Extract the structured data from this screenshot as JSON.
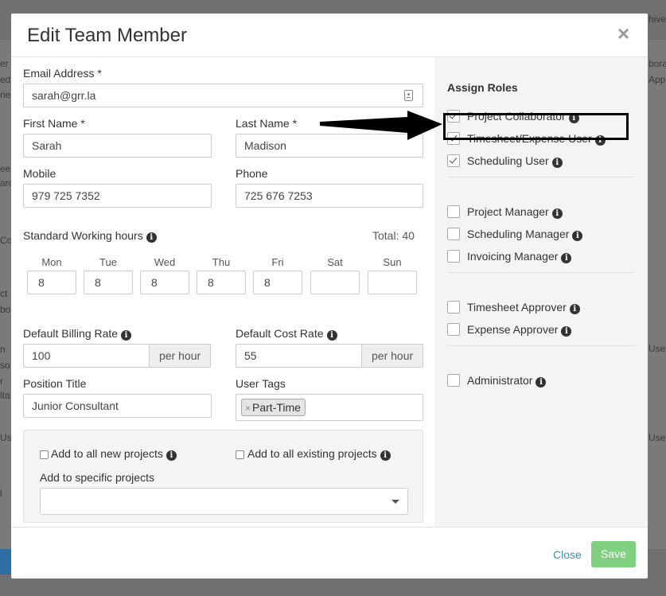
{
  "modal": {
    "title": "Edit Team Member",
    "close_glyph": "×"
  },
  "form": {
    "email_label": "Email Address",
    "email_value": "sarah@grr.la",
    "first_name_label": "First Name",
    "first_name_value": "Sarah",
    "last_name_label": "Last Name",
    "last_name_value": "Madison",
    "mobile_label": "Mobile",
    "mobile_value": "979 725 7352",
    "phone_label": "Phone",
    "phone_value": "725 676 7253",
    "required_mark": "*",
    "hours_label": "Standard Working hours",
    "hours_total": "Total: 40",
    "days": [
      {
        "name": "Mon",
        "value": "8"
      },
      {
        "name": "Tue",
        "value": "8"
      },
      {
        "name": "Wed",
        "value": "8"
      },
      {
        "name": "Thu",
        "value": "8"
      },
      {
        "name": "Fri",
        "value": "8"
      },
      {
        "name": "Sat",
        "value": ""
      },
      {
        "name": "Sun",
        "value": ""
      }
    ],
    "billing_rate_label": "Default Billing Rate",
    "billing_rate_value": "100",
    "cost_rate_label": "Default Cost Rate",
    "cost_rate_value": "55",
    "per_hour": "per hour",
    "position_label": "Position Title",
    "position_value": "Junior Consultant",
    "tags_label": "User Tags",
    "tags": [
      "Part-Time"
    ],
    "tag_remove_glyph": "×",
    "add_new_projects": "Add to all new projects",
    "add_existing_projects": "Add to all existing projects",
    "add_specific_projects": "Add to specific projects",
    "info_glyph": "i"
  },
  "roles": {
    "title": "Assign Roles",
    "groups": [
      [
        {
          "label": "Project Collaborator",
          "checked": true
        },
        {
          "label": "Timesheet/Expense User",
          "checked": true
        },
        {
          "label": "Scheduling User",
          "checked": true
        }
      ],
      [
        {
          "label": "Project Manager",
          "checked": false
        },
        {
          "label": "Scheduling Manager",
          "checked": false
        },
        {
          "label": "Invoicing Manager",
          "checked": false
        }
      ],
      [
        {
          "label": "Timesheet Approver",
          "checked": false
        },
        {
          "label": "Expense Approver",
          "checked": false
        }
      ],
      [
        {
          "label": "Administrator",
          "checked": false
        }
      ]
    ]
  },
  "footer": {
    "close_label": "Close",
    "save_label": "Save"
  },
  "background": {
    "right_fragments": [
      "hive",
      "bora",
      "Appr",
      "Use",
      "Use"
    ],
    "left_fragments": [
      "er",
      "ed",
      "ne",
      "ee",
      "arc",
      "Col",
      "ct",
      "bo",
      "n",
      "so",
      "r",
      "lta",
      "Us",
      "l"
    ]
  },
  "colors": {
    "overlay": "#707070",
    "link": "#3a8fb7",
    "save_button": "#7fd17f",
    "roles_panel": "#f4f4f4"
  }
}
